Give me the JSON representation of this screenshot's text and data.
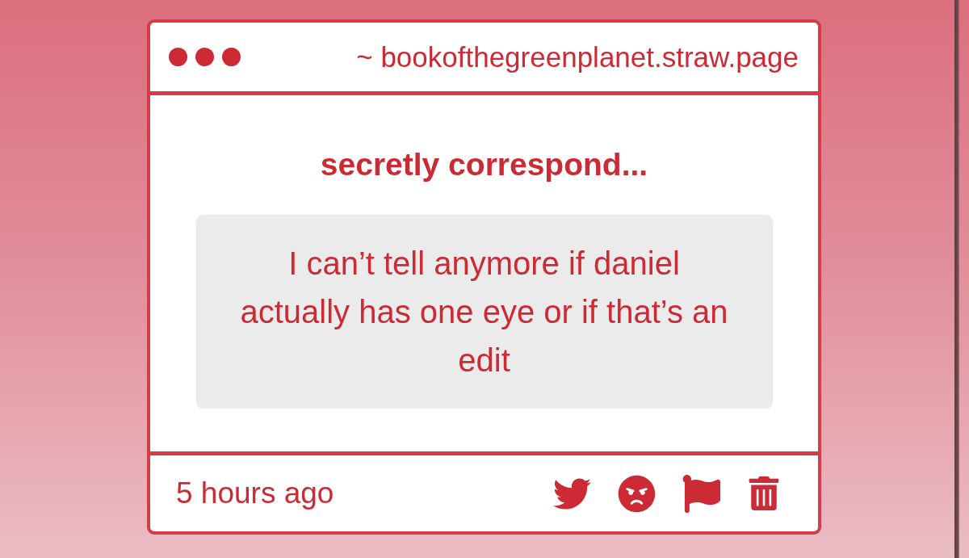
{
  "window": {
    "url": "~ bookofthegreenplanet.straw.page"
  },
  "post": {
    "title": "secretly correspond...",
    "message": "I can’t tell anymore if daniel actually has one eye or if that’s an edit"
  },
  "footer": {
    "time": "5 hours ago",
    "actions": [
      {
        "kind": "twitter"
      },
      {
        "kind": "angry"
      },
      {
        "kind": "flag"
      },
      {
        "kind": "trash"
      }
    ]
  }
}
